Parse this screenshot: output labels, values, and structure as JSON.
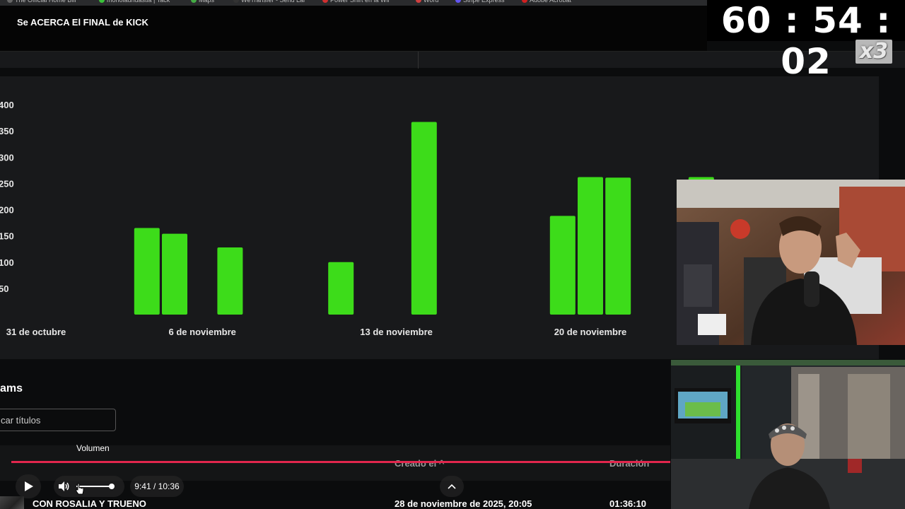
{
  "bookmarks": [
    {
      "label": "The Official Home Bill",
      "color": "#666666"
    },
    {
      "label": "monolaundastia | Tack",
      "color": "#3ac03a"
    },
    {
      "label": "Maps",
      "color": "#44aa44"
    },
    {
      "label": "WeTransfer - Send Lar",
      "color": "#333333"
    },
    {
      "label": "Power Shirt en la Wil",
      "color": "#d03030"
    },
    {
      "label": "Word",
      "color": "#d04040"
    },
    {
      "label": "Stripe Express",
      "color": "#6255f0"
    },
    {
      "label": "Adobe Acrobat",
      "color": "#d02020"
    }
  ],
  "video": {
    "title": "Se ACERCA El FINAL de KICK",
    "elapsed": "9:41 / 10:36",
    "volume_tooltip": "Volumen",
    "progress": 1.0,
    "volume_level": 0.9
  },
  "overlay": {
    "timer": "60 : 54 : 02",
    "multiplier": "x3"
  },
  "chart_data": {
    "type": "bar",
    "title": "",
    "xlabel": "",
    "ylabel": "",
    "color": "#3ddc1a",
    "y_ticks": [
      "400",
      "350",
      "300",
      "250",
      "200",
      "150",
      "100",
      "50"
    ],
    "ylim": [
      0,
      400
    ],
    "x_tick_labels": [
      "31 de octubre",
      "6 de noviembre",
      "13 de noviembre",
      "20 de noviembre"
    ],
    "bars": [
      {
        "date": "4 de noviembre",
        "value": 165
      },
      {
        "date": "5 de noviembre",
        "value": 154
      },
      {
        "date": "7 de noviembre",
        "value": 128
      },
      {
        "date": "11 de noviembre",
        "value": 100
      },
      {
        "date": "14 de noviembre",
        "value": 367
      },
      {
        "date": "19 de noviembre",
        "value": 188
      },
      {
        "date": "20 de noviembre",
        "value": 262
      },
      {
        "date": "21 de noviembre",
        "value": 261
      },
      {
        "date": "24 de noviembre",
        "value": 262
      }
    ]
  },
  "streams": {
    "heading": "ams",
    "search_placeholder": "car títulos",
    "columns": {
      "created": "Creado el ^",
      "duration": "Duración"
    },
    "rows": [
      {
        "title": "CON ROSALIA Y TRUENO",
        "created": "28 de noviembre de 2025, 20:05",
        "duration": "01:36:10"
      }
    ]
  },
  "colors": {
    "bar": "#3ddc1a",
    "progress": "#e2264d",
    "panel": "#18191b",
    "background": "#0b0c0d"
  }
}
